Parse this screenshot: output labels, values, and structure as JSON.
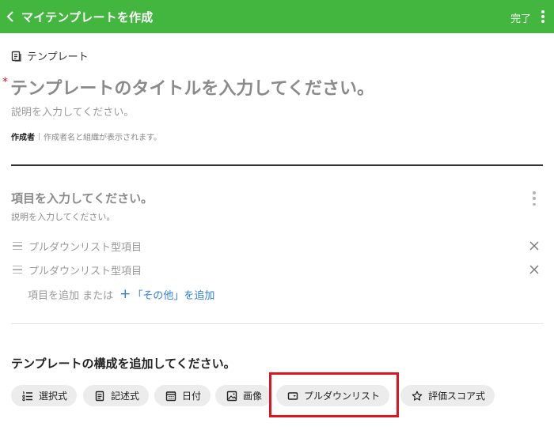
{
  "header": {
    "title": "マイテンプレートを作成",
    "done_label": "完了"
  },
  "template": {
    "label": "テンプレート",
    "title_placeholder": "テンプレートのタイトルを入力してください。",
    "required_mark": "*",
    "description_placeholder": "説明を入力してください。",
    "author_label": "作成者",
    "author_note": "作成者名と組織が表示されます。"
  },
  "item": {
    "title_placeholder": "項目を入力してください。",
    "description_placeholder": "説明を入力してください。",
    "options": [
      "プルダウンリスト型項目",
      "プルダウンリスト型項目"
    ],
    "add_text": "項目を追加 または",
    "add_other": "「その他」を追加"
  },
  "compose": {
    "title": "テンプレートの構成を追加してください。",
    "chips": [
      {
        "label": "選択式",
        "icon": "list-icon"
      },
      {
        "label": "記述式",
        "icon": "document-icon"
      },
      {
        "label": "日付",
        "icon": "calendar-icon"
      },
      {
        "label": "画像",
        "icon": "image-icon"
      },
      {
        "label": "プルダウンリスト",
        "icon": "dropdown-icon"
      },
      {
        "label": "評価スコア式",
        "icon": "star-icon"
      }
    ]
  },
  "colors": {
    "header_bg": "#43b63f",
    "link": "#2f7fdc",
    "required": "#e0141e",
    "highlight": "#e0141e"
  }
}
